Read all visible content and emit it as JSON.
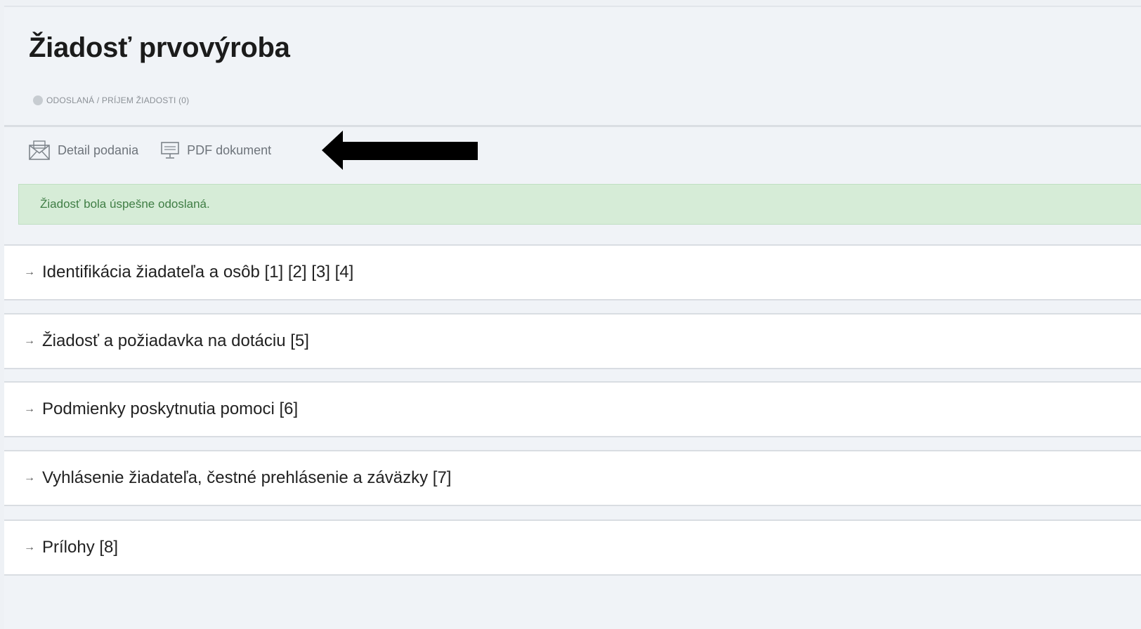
{
  "header": {
    "title": "Žiadosť prvovýroba",
    "status": "ODOSLANÁ / PRÍJEM ŽIADOSTI (0)"
  },
  "toolbar": {
    "detail_label": "Detail podania",
    "pdf_label": "PDF dokument"
  },
  "alert": {
    "message": "Žiadosť bola úspešne odoslaná."
  },
  "sections": [
    {
      "arrow": "→",
      "label": "Identifikácia žiadateľa a osôb [1] [2] [3] [4]"
    },
    {
      "arrow": "→",
      "label": "Žiadosť a požiadavka na dotáciu [5]"
    },
    {
      "arrow": "→",
      "label": "Podmienky poskytnutia pomoci [6]"
    },
    {
      "arrow": "→",
      "label": "Vyhlásenie žiadateľa, čestné prehlásenie a záväzky [7]"
    },
    {
      "arrow": "→",
      "label": "Prílohy [8]"
    }
  ],
  "icons": {
    "status": "status-dot-icon",
    "detail": "envelope-icon",
    "pdf": "pdf-monitor-icon",
    "pointer": "pointer-arrow-icon"
  },
  "colors": {
    "alert_background": "#d6ecd7",
    "alert_text": "#3f7d44",
    "page_background": "#f0f3f7"
  }
}
